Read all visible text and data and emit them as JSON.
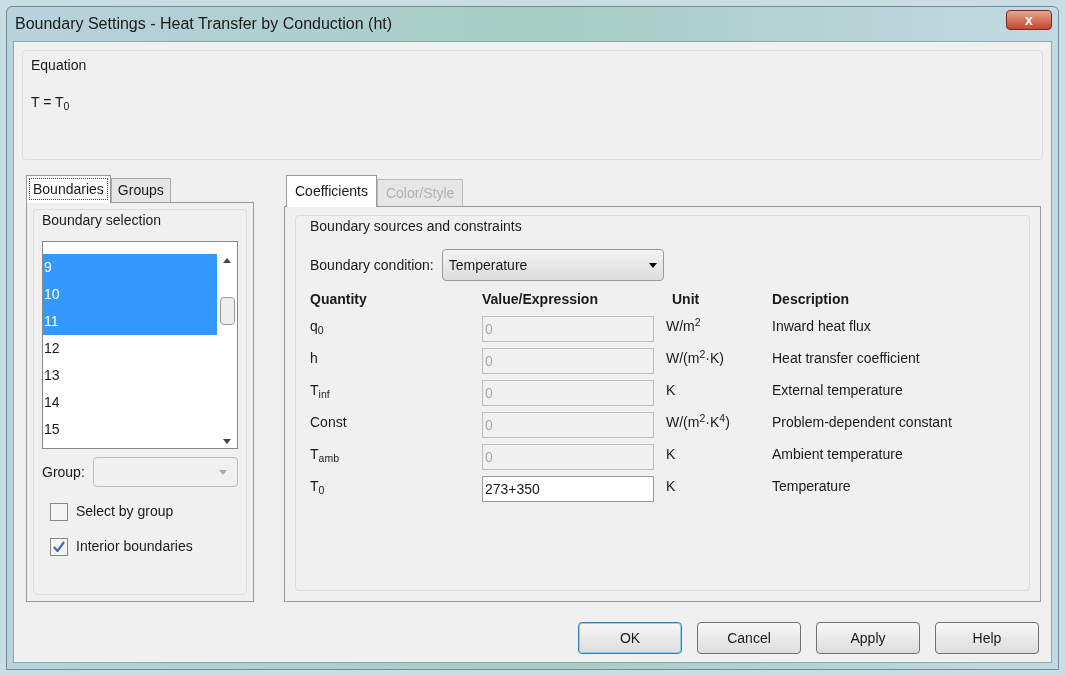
{
  "window": {
    "title": "Boundary Settings - Heat Transfer by Conduction (ht)",
    "close": "x"
  },
  "equation": {
    "title": "Equation",
    "formula": "T = T$_{0}$"
  },
  "left_tabs": [
    {
      "label": "Boundaries",
      "selected": true
    },
    {
      "label": "Groups",
      "selected": false
    }
  ],
  "boundary_selection": {
    "title": "Boundary selection",
    "items": [
      {
        "label": "9",
        "selected": true
      },
      {
        "label": "10",
        "selected": true
      },
      {
        "label": "11",
        "selected": true
      },
      {
        "label": "12",
        "selected": false
      },
      {
        "label": "13",
        "selected": false
      },
      {
        "label": "14",
        "selected": false
      },
      {
        "label": "15",
        "selected": false
      }
    ],
    "group_label": "Group:",
    "checkboxes": [
      {
        "label": "Select by group",
        "checked": false
      },
      {
        "label": "Interior boundaries",
        "checked": true
      }
    ]
  },
  "right_tabs": [
    {
      "label": "Coefficients",
      "selected": true,
      "disabled": false
    },
    {
      "label": "Color/Style",
      "selected": false,
      "disabled": true
    }
  ],
  "coefficients": {
    "title": "Boundary sources and constraints",
    "condition_label": "Boundary condition:",
    "condition_value": "Temperature",
    "columns": [
      "Quantity",
      "Value/Expression",
      "Unit",
      "Description"
    ],
    "rows": [
      {
        "quantity": "q$_{0}$",
        "value": "0",
        "disabled": true,
        "unit": "W/m$^{2}$",
        "description": "Inward heat flux"
      },
      {
        "quantity": "h",
        "value": "0",
        "disabled": true,
        "unit": "W/(m$^{2}$·K)",
        "description": "Heat transfer coefficient"
      },
      {
        "quantity": "T$_{inf}$",
        "value": "0",
        "disabled": true,
        "unit": "K",
        "description": "External temperature"
      },
      {
        "quantity": "Const",
        "value": "0",
        "disabled": true,
        "unit": "W/(m$^{2}$·K$^{4}$)",
        "description": "Problem-dependent constant"
      },
      {
        "quantity": "T$_{amb}$",
        "value": "0",
        "disabled": true,
        "unit": "K",
        "description": "Ambient temperature"
      },
      {
        "quantity": "T$_{0}$",
        "value": "273+350",
        "disabled": false,
        "unit": "K",
        "description": "Temperature"
      }
    ]
  },
  "buttons": [
    {
      "label": "OK",
      "default": true
    },
    {
      "label": "Cancel",
      "default": false
    },
    {
      "label": "Apply",
      "default": false
    },
    {
      "label": "Help",
      "default": false
    }
  ]
}
